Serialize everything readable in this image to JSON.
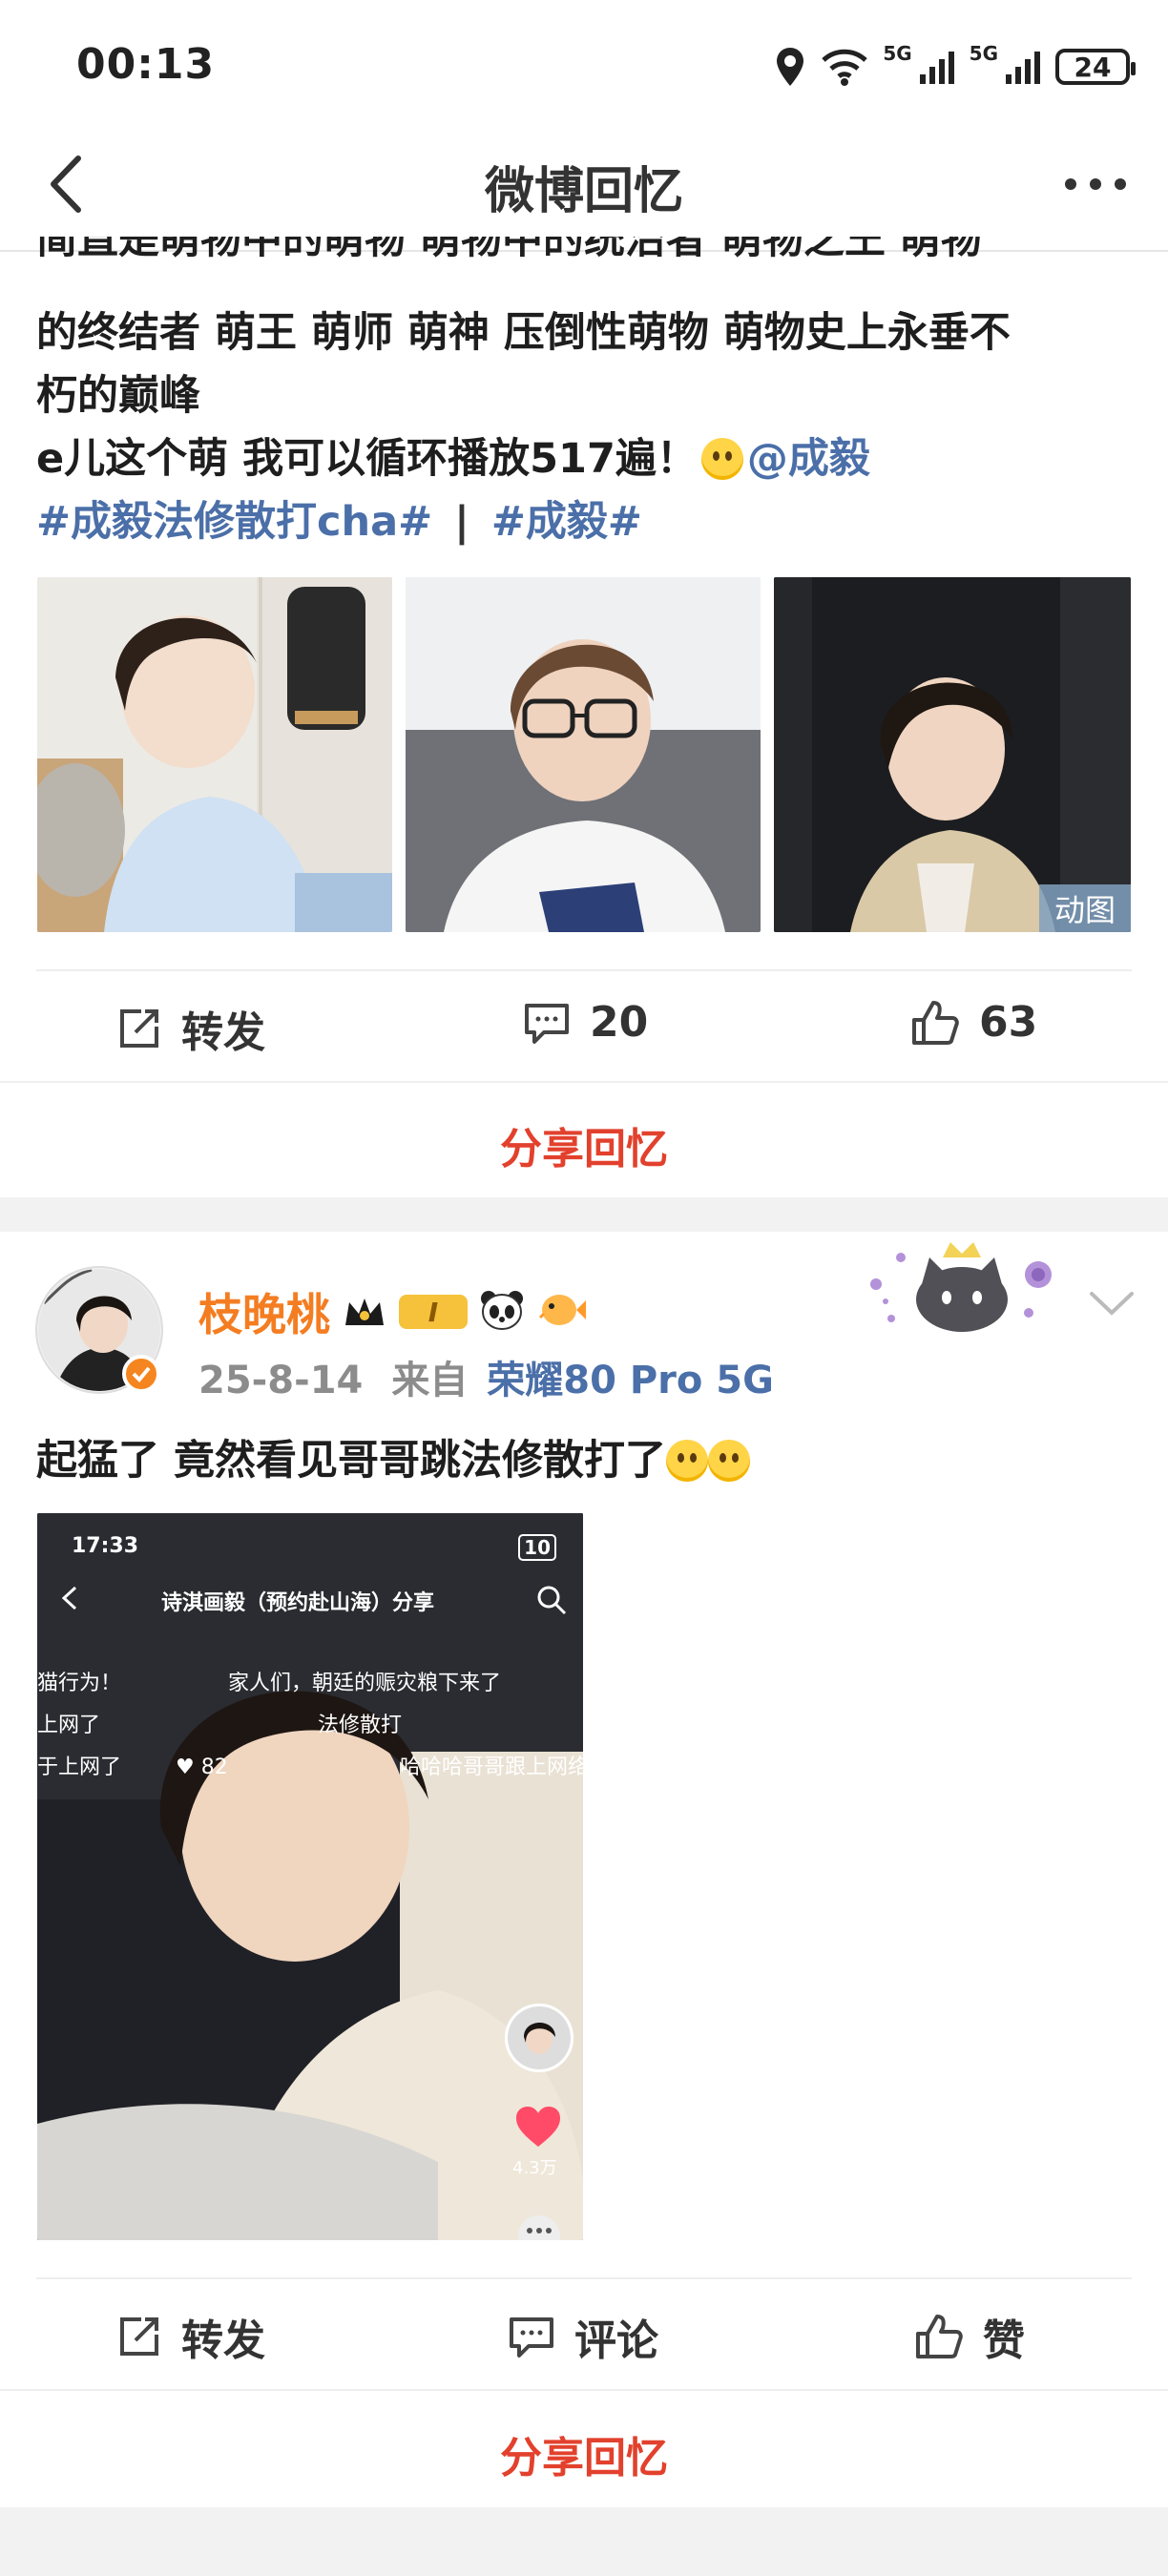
{
  "status_bar": {
    "time": "00:13",
    "signal1": "5G",
    "signal2": "5G",
    "battery": "24"
  },
  "nav": {
    "title": "微博回忆"
  },
  "post1": {
    "text_line1": "简直是萌物中的萌物 萌物中的统治者 萌物之王 萌物",
    "text_line2": "的终结者 萌王 萌师 萌神 压倒性萌物 萌物史上永垂不",
    "text_line3": "朽的巅峰",
    "text_line4": "e儿这个萌 我可以循环播放517遍！",
    "mention": "@成毅",
    "topic1": "#成毅法修散打cha#",
    "separator": "|",
    "topic2": "#成毅#",
    "gif_badge": "动图",
    "repost_label": "转发",
    "comment_count": "20",
    "like_count": "63",
    "share_label": "分享回忆"
  },
  "post2": {
    "username": "枝晚桃",
    "level_badge": "I",
    "date": "25-8-14",
    "source_prefix": "来自",
    "source_device": "荣耀80 Pro 5G",
    "text": "起猛了 竟然看见哥哥跳法修散打了",
    "embedded": {
      "time": "17:33",
      "battery": "10",
      "header": "诗淇画毅",
      "header_suffix": "（预约赴山海）分享",
      "danmu1": "猫行为！",
      "danmu2": "家人们，朝廷的赈灾粮下来了",
      "danmu3": "上网了",
      "danmu4": "法修散打",
      "danmu5": "于上网了",
      "danmu5_count": "82",
      "danmu6": "哈哈哈哥哥跟上网络",
      "like_count": "4.3万"
    },
    "repost_label": "转发",
    "comment_label": "评论",
    "like_label": "赞",
    "share_label": "分享回忆"
  },
  "colors": {
    "accent_red": "#e2412d",
    "topic_blue": "#4b6fa8",
    "username_orange": "#f47d22"
  }
}
